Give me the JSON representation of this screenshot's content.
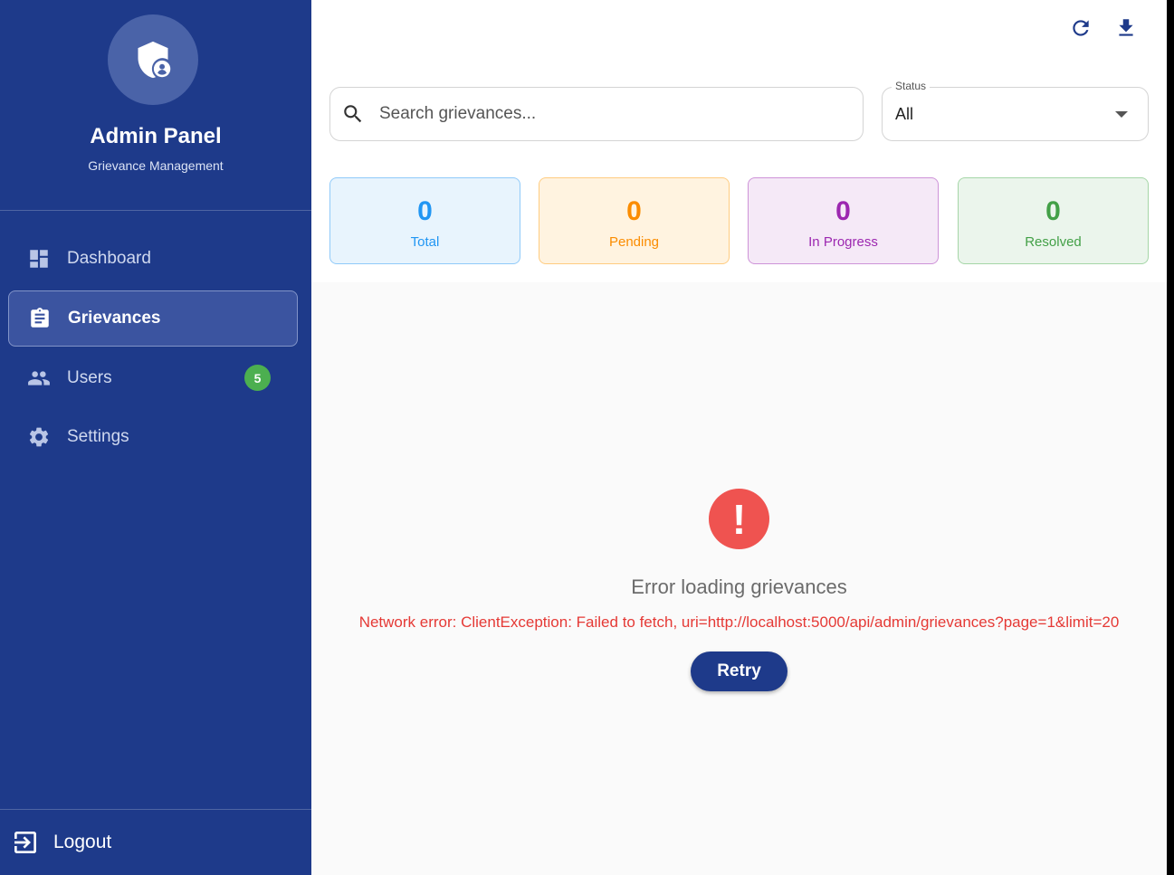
{
  "sidebar": {
    "title": "Admin Panel",
    "subtitle": "Grievance Management",
    "logo_icon": "shield-person-icon",
    "items": [
      {
        "label": "Dashboard",
        "icon": "dashboard-icon",
        "active": false
      },
      {
        "label": "Grievances",
        "icon": "clipboard-icon",
        "active": true
      },
      {
        "label": "Users",
        "icon": "people-icon",
        "active": false,
        "badge": "5"
      },
      {
        "label": "Settings",
        "icon": "gear-icon",
        "active": false
      }
    ],
    "logout_label": "Logout"
  },
  "toolbar": {
    "refresh_icon": "refresh-icon",
    "download_icon": "download-icon"
  },
  "search": {
    "placeholder": "Search grievances...",
    "value": ""
  },
  "status_filter": {
    "label": "Status",
    "value": "All"
  },
  "stats": [
    {
      "value": "0",
      "label": "Total",
      "color": "#2196f3",
      "bg": "#e8f4fd",
      "border": "#90caf9"
    },
    {
      "value": "0",
      "label": "Pending",
      "color": "#fb8c00",
      "bg": "#fff3e0",
      "border": "#ffcc80"
    },
    {
      "value": "0",
      "label": "In Progress",
      "color": "#9c27b0",
      "bg": "#f5e9f7",
      "border": "#ce93d8"
    },
    {
      "value": "0",
      "label": "Resolved",
      "color": "#43a047",
      "bg": "#ebf5ec",
      "border": "#a5d6a7"
    }
  ],
  "error": {
    "title": "Error loading grievances",
    "message": "Network error: ClientException: Failed to fetch, uri=http://localhost:5000/api/admin/grievances?page=1&limit=20",
    "retry_label": "Retry"
  },
  "colors": {
    "sidebar_bg": "#1e3a8a",
    "accent": "#1e3a8a",
    "error": "#ef5350",
    "badge": "#4caf50"
  }
}
